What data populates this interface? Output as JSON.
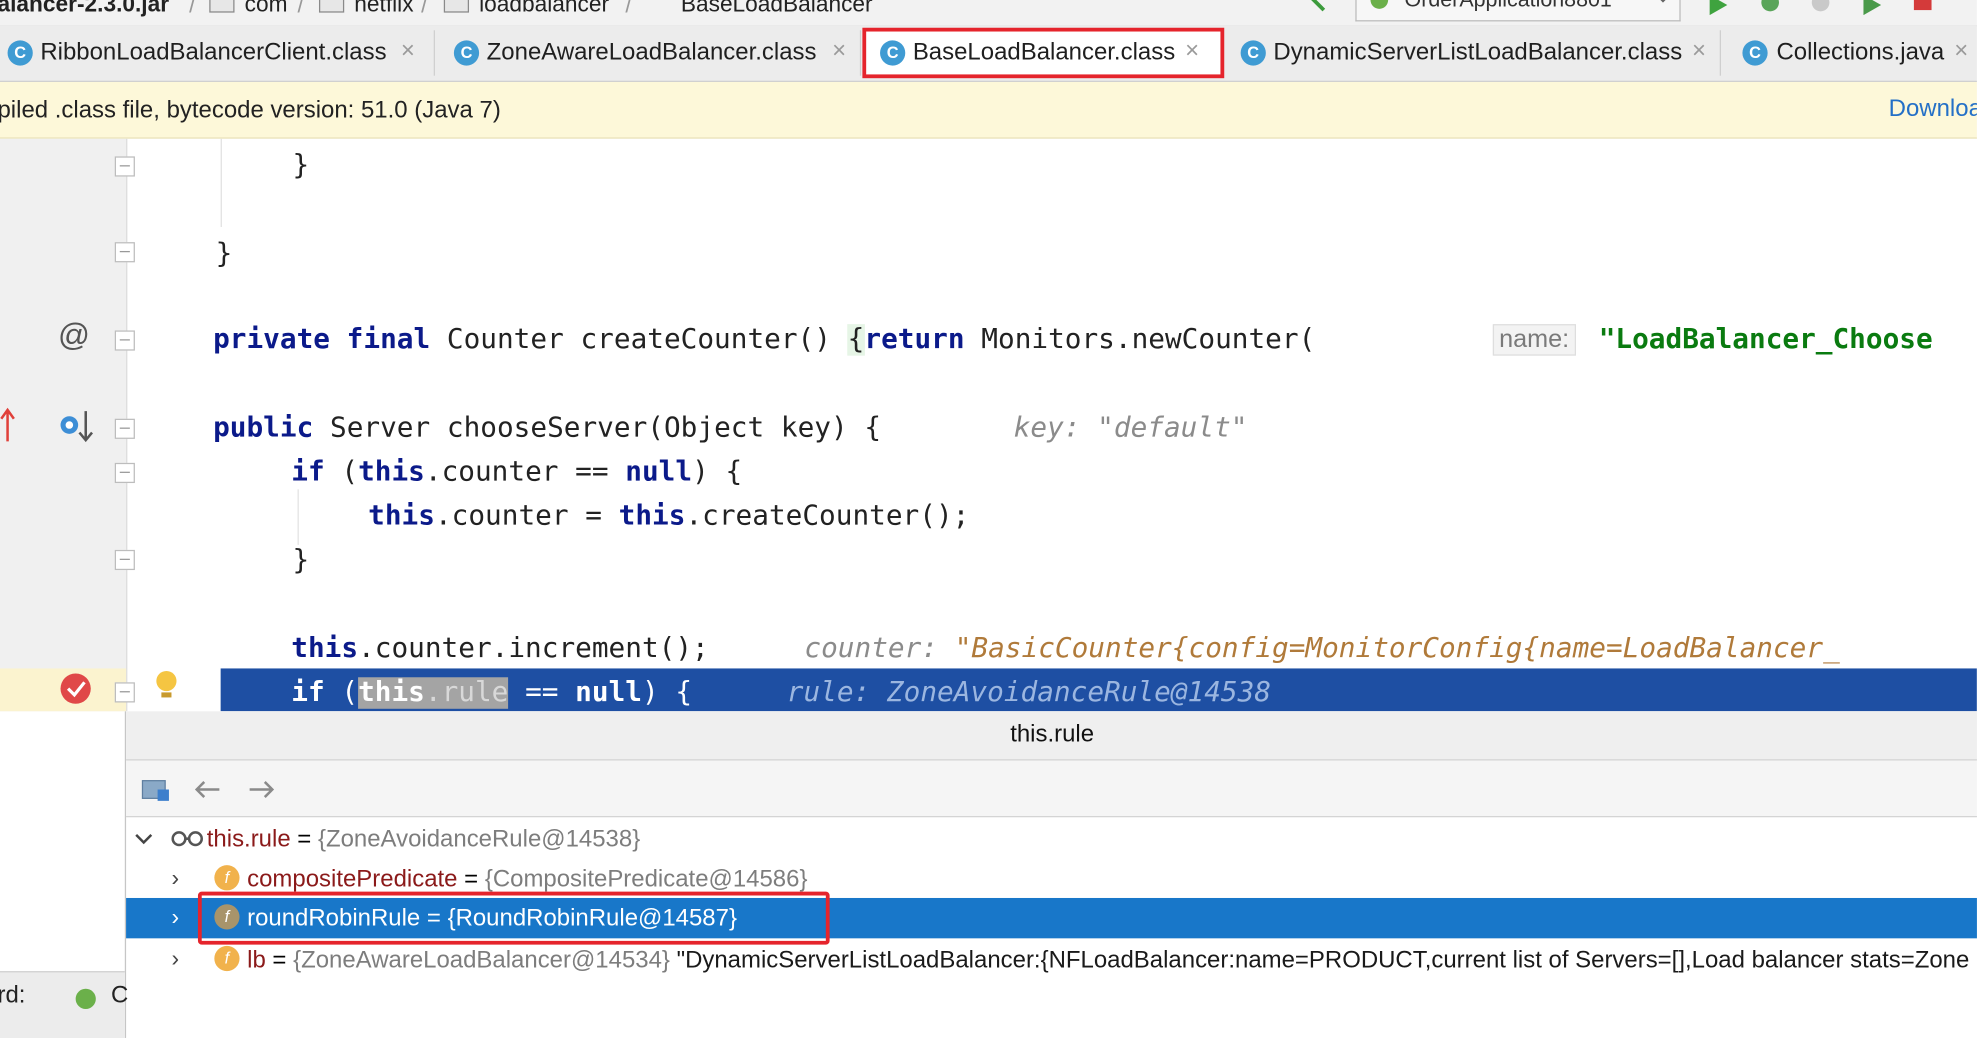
{
  "breadcrumb": {
    "items": [
      "alancer-2.3.0.jar",
      "com",
      "netflix",
      "loadbalancer",
      "BaseLoadBalancer"
    ],
    "run_config": "OrderApplication8801"
  },
  "tabs": [
    {
      "label": "RibbonLoadBalancerClient.class",
      "icon": "C",
      "active": false
    },
    {
      "label": "ZoneAwareLoadBalancer.class",
      "icon": "C",
      "active": false
    },
    {
      "label": "BaseLoadBalancer.class",
      "icon": "C",
      "active": true
    },
    {
      "label": "DynamicServerListLoadBalancer.class",
      "icon": "C",
      "active": false
    },
    {
      "label": "Collections.java",
      "icon": "C",
      "active": false
    }
  ],
  "notification": {
    "message": "piled .class file, bytecode version: 51.0 (Java 7)",
    "download": "Downloa"
  },
  "code": {
    "l1": "}",
    "l2": "}",
    "l3_kw": "private final",
    "l3_a": " Counter createCounter() ",
    "l3_brace": "{",
    "l3_ret": "return",
    "l3_b": " Monitors.newCounter(",
    "l3_param": "name:",
    "l3_str": "\"LoadBalancer_Choose",
    "l4_kw": "public",
    "l4_a": " Server chooseServer(Object key) {",
    "l4_hint": "key: \"default\"",
    "l5_if": "if",
    "l5_a": " (",
    "l5_this": "this",
    "l5_b": ".counter == ",
    "l5_null": "null",
    "l5_c": ") {",
    "l6_this": "this",
    "l6_a": ".counter = ",
    "l6_this2": "this",
    "l6_b": ".createCounter();",
    "l7": "}",
    "l8_this": "this",
    "l8_a": ".counter.increment();",
    "l8_hint_k": "counter:",
    "l8_hint_v": "\"BasicCounter{config=MonitorConfig{name=LoadBalancer_",
    "l9_if": "if",
    "l9_a": " (",
    "l9_this": "this",
    "l9_rule": ".rule",
    "l9_b": " == ",
    "l9_null": "null",
    "l9_c": ") {",
    "l9_hint": "rule: ZoneAvoidanceRule@14538"
  },
  "popup": {
    "title": "this.rule",
    "root": {
      "name": "this.rule",
      "eq": " = ",
      "value": "{ZoneAvoidanceRule@14538}"
    },
    "children": [
      {
        "name": "compositePredicate",
        "eq": " = ",
        "value": "{CompositePredicate@14586}",
        "extra": ""
      },
      {
        "name": "roundRobinRule",
        "eq": " = ",
        "value": "{RoundRobinRule@14587}",
        "extra": ""
      },
      {
        "name": "lb",
        "eq": " = ",
        "value": "{ZoneAwareLoadBalancer@14534}",
        "extra": " \"DynamicServerListLoadBalancer:{NFLoadBalancer:name=PRODUCT,current list of Servers=[],Load balancer stats=Zone"
      }
    ]
  },
  "bottom_left": {
    "label": "rd:",
    "label2": "C"
  },
  "colors": {
    "highlight": "#1e4fa3",
    "selection": "#1877c9",
    "annotation": "#e5242c"
  }
}
